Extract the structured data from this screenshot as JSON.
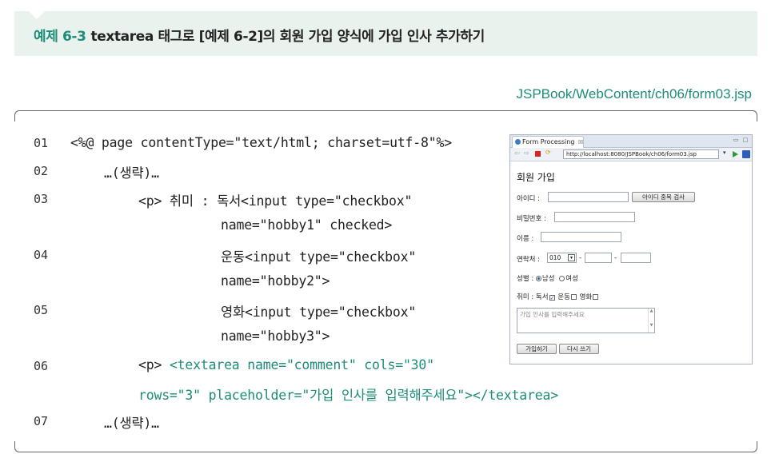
{
  "banner": {
    "number": "예제 6-3",
    "title": "textarea 태그로 [예제 6-2]의 회원 가입 양식에 가입 인사 추가하기"
  },
  "file_path": "JSPBook/WebContent/ch06/form03.jsp",
  "code_lines": [
    {
      "num": "01",
      "text": "<%@ page contentType=\"text/html; charset=utf-8\"%>"
    },
    {
      "num": "02",
      "text": "…(생략)…"
    },
    {
      "num": "03",
      "text": "<p> 취미 : 독서<input type=\"checkbox\""
    },
    {
      "num": "",
      "text": "name=\"hobby1\" checked>"
    },
    {
      "num": "04",
      "text": "운동<input type=\"checkbox\""
    },
    {
      "num": "",
      "text": "name=\"hobby2\">"
    },
    {
      "num": "05",
      "text": "영화<input type=\"checkbox\""
    },
    {
      "num": "",
      "text": "name=\"hobby3\">"
    },
    {
      "num": "06",
      "text_plain": "<p> ",
      "text_hl": "<textarea name=\"comment\" cols=\"30\""
    },
    {
      "num": "",
      "text_hl": "rows=\"3\" placeholder=\"가입 인사를 입력해주세요\"></textarea>"
    },
    {
      "num": "07",
      "text": "…(생략)…"
    }
  ],
  "browser": {
    "tab_label": "Form Processing",
    "tab_close": "☒",
    "url": "http://localhost:8080/JSPBook/ch06/form03.jsp",
    "heading": "회원 가입",
    "id_label": "아이디 :",
    "id_check_button": "아이디 중복 검사",
    "password_label": "비밀번호 :",
    "name_label": "이름 :",
    "phone_label": "연락처 :",
    "phone_prefix": "010",
    "phone_sep": "-",
    "gender_label": "성별 :",
    "gender_male": "남성",
    "gender_female": "여성",
    "hobby_label": "취미 : 독서",
    "hobby_sports": "운동",
    "hobby_movie": "영화",
    "textarea_placeholder": "가입 인사를 입력해주세요",
    "submit_button": "가입하기",
    "reset_button": "다시 쓰기"
  }
}
